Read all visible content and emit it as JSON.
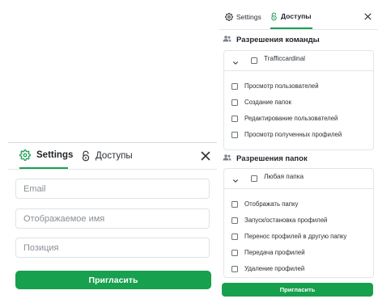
{
  "invite_panel": {
    "tabs": {
      "settings_label": "Settings",
      "access_label": "Доступы"
    },
    "fields": {
      "email_placeholder": "Email",
      "display_name_placeholder": "Отображаемое имя",
      "position_placeholder": "Позиция"
    },
    "invite_button_label": "Пригласить"
  },
  "access_panel": {
    "tabs": {
      "settings_label": "Settings",
      "access_label": "Доступы"
    },
    "team_permissions": {
      "title": "Разрешения команды",
      "group_name": "Trafficcardinal",
      "items": [
        "Просмотр пользователей",
        "Создание папок",
        "Редактирование пользователей",
        "Просмотр полученных профилей"
      ]
    },
    "folder_permissions": {
      "title": "Разрешения папок",
      "group_name": "Любая папка",
      "items": [
        "Отображать папку",
        "Запуск/остановка профилей",
        "Перенос профилей в другую папку",
        "Передача профилей",
        "Удаление профилей"
      ]
    },
    "invite_button_label": "Пригласить"
  },
  "colors": {
    "accent": "#17a04e",
    "tab_underline": "#1a9f52",
    "border": "#dfe2e5"
  },
  "icons": {
    "settings": "gear-icon",
    "access": "lock-icon",
    "close": "close-icon",
    "team": "users-icon",
    "expand": "chevron-down-icon"
  }
}
